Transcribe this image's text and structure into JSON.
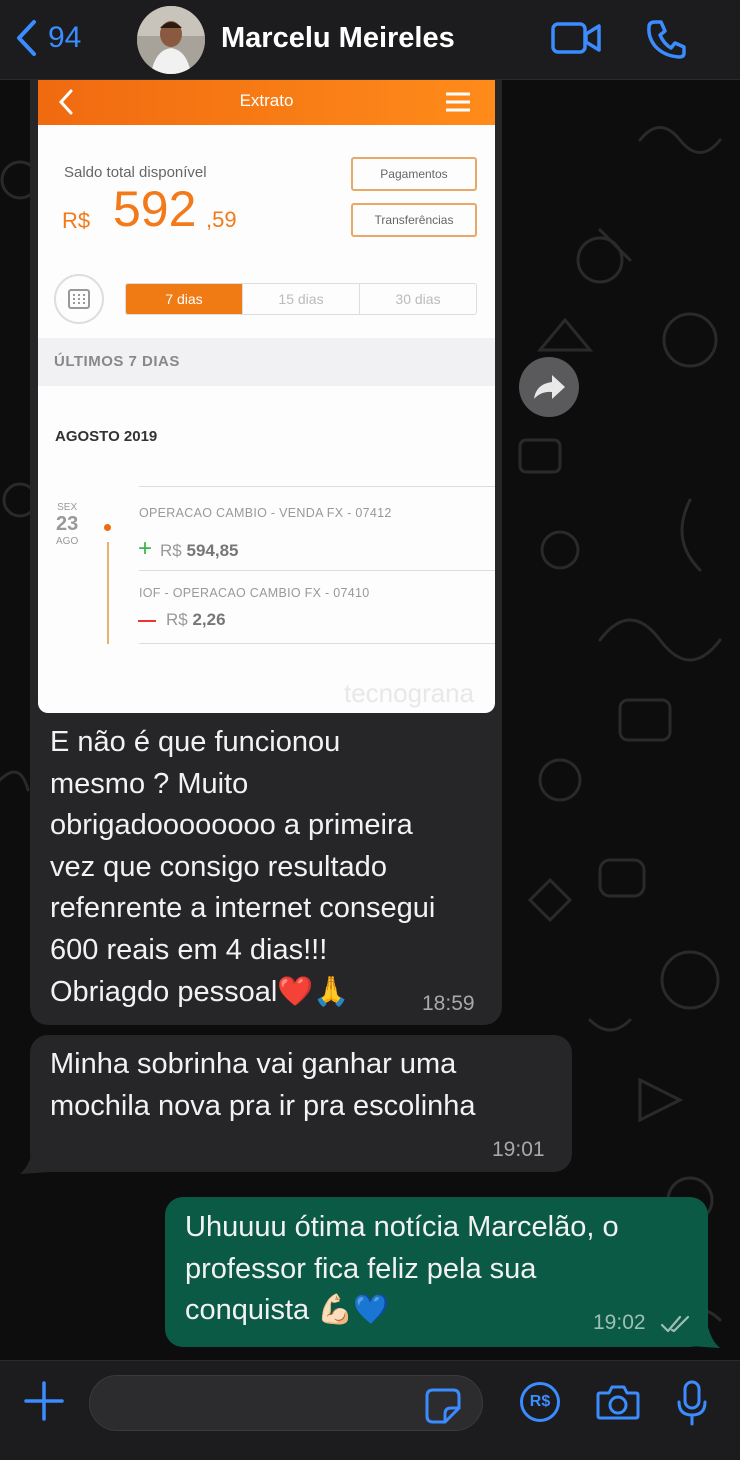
{
  "header": {
    "back_count": "94",
    "contact_name": "Marcelu Meireles",
    "icons": [
      "chevron-left-icon",
      "video-call-icon",
      "phone-call-icon"
    ]
  },
  "shared_image": {
    "title": "Extrato",
    "balance_label": "Saldo total disponível",
    "currency": "R$",
    "balance_int": "592",
    "balance_cents": ",59",
    "button_payments": "Pagamentos",
    "button_transfers": "Transferências",
    "tabs": [
      "7 dias",
      "15 dias",
      "30 dias"
    ],
    "section": "ÚLTIMOS 7 DIAS",
    "month": "AGOSTO 2019",
    "day_weekday": "SEX",
    "day_number": "23",
    "day_month": "AGO",
    "transactions": [
      {
        "desc": "OPERACAO CAMBIO - VENDA FX - 07412",
        "currency": "R$",
        "amount": "594,85",
        "type": "credit"
      },
      {
        "desc": "IOF - OPERACAO CAMBIO FX - 07410",
        "currency": "R$",
        "amount": "2,26",
        "type": "debit"
      }
    ],
    "watermark": "tecnograna"
  },
  "messages": [
    {
      "lines": [
        "E não é que funcionou",
        "mesmo ? Muito",
        "obrigadoooooooo a primeira",
        "vez que consigo resultado",
        "refenrente a internet consegui",
        "600 reais em 4 dias!!!",
        "Obriagdo pessoal❤️🙏"
      ],
      "time": "18:59",
      "direction": "incoming"
    },
    {
      "lines": [
        "Minha sobrinha vai ganhar uma",
        "mochila nova pra ir pra escolinha"
      ],
      "time": "19:01",
      "direction": "incoming"
    },
    {
      "lines": [
        "Uhuuuu ótima notícia Marcelão, o",
        "professor fica feliz pela sua",
        "conquista 💪🏻💙"
      ],
      "time": "19:02",
      "direction": "outgoing",
      "status": "read"
    }
  ],
  "input_bar": {
    "icons": [
      "plus-icon",
      "sticker-icon",
      "payment-icon",
      "camera-icon",
      "microphone-icon"
    ],
    "payment_label": "R$"
  },
  "colors": {
    "accent": "#3a8cff",
    "incoming_bubble": "#262628",
    "outgoing_bubble": "#0b5a45",
    "brand_orange": "#f27a1a"
  }
}
